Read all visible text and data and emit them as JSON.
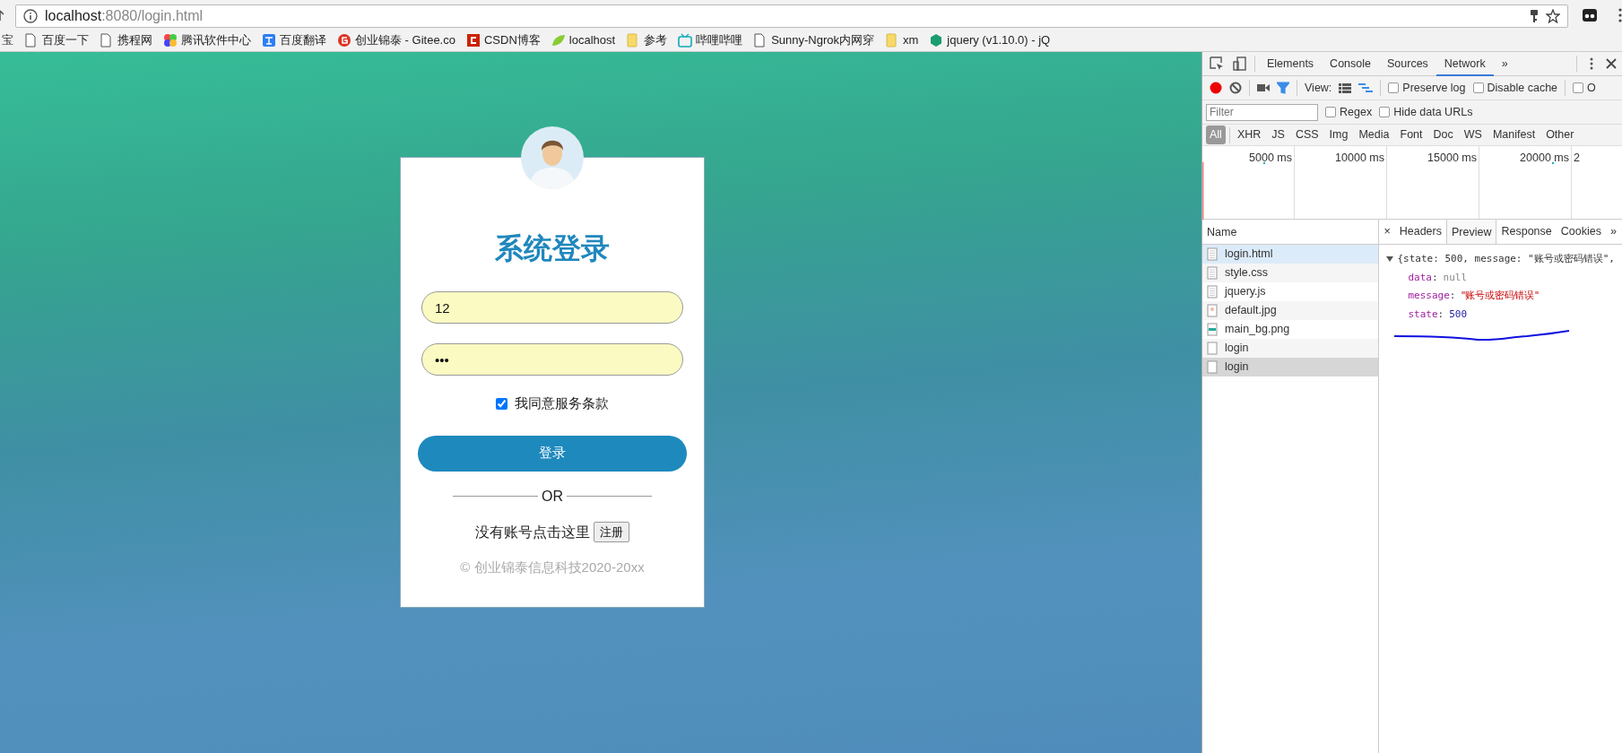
{
  "browser": {
    "url": {
      "host": "localhost",
      "rest": ":8080/login.html"
    },
    "bookmarks": [
      {
        "kind": "none",
        "label": "宝"
      },
      {
        "kind": "page",
        "label": "百度一下"
      },
      {
        "kind": "page",
        "label": "携程网"
      },
      {
        "kind": "pinwheel",
        "label": "腾讯软件中心"
      },
      {
        "kind": "translate",
        "label": "百度翻译"
      },
      {
        "kind": "gitee",
        "label": "创业锦泰 - Gitee.co"
      },
      {
        "kind": "csdn",
        "label": "CSDN博客"
      },
      {
        "kind": "leaf",
        "label": "localhost"
      },
      {
        "kind": "folder",
        "label": "参考"
      },
      {
        "kind": "tv",
        "label": "哔哩哔哩"
      },
      {
        "kind": "page",
        "label": "Sunny-Ngrok内网穿"
      },
      {
        "kind": "folder",
        "label": "xm"
      },
      {
        "kind": "hex",
        "label": "jquery (v1.10.0) - jQ"
      }
    ]
  },
  "login": {
    "title": "系统登录",
    "username": "12",
    "password": "•••",
    "agree": {
      "label": "我同意服务条款",
      "checked": true
    },
    "submit": "登录",
    "divider": "OR",
    "register_prompt": "没有账号点击这里",
    "register_button": "注册",
    "copyright": "© 创业锦泰信息科技2020-20xx"
  },
  "devtools": {
    "tabs": [
      {
        "label": "Elements",
        "selected": false
      },
      {
        "label": "Console",
        "selected": false
      },
      {
        "label": "Sources",
        "selected": false
      },
      {
        "label": "Network",
        "selected": true
      }
    ],
    "tabs_more": "»",
    "toolbar": {
      "recording": true,
      "filter_on": true,
      "view_label": "View:",
      "waterfall_view": true,
      "checkboxes": [
        {
          "label": "Preserve log",
          "checked": false
        },
        {
          "label": "Disable cache",
          "checked": false
        },
        {
          "label": "O",
          "checked": false
        }
      ]
    },
    "filter": {
      "placeholder": "Filter",
      "checkboxes": [
        {
          "label": "Regex",
          "checked": false
        },
        {
          "label": "Hide data URLs",
          "checked": false
        }
      ]
    },
    "types": [
      {
        "label": "All",
        "selected": true
      },
      {
        "label": "XHR",
        "selected": false
      },
      {
        "label": "JS",
        "selected": false
      },
      {
        "label": "CSS",
        "selected": false
      },
      {
        "label": "Img",
        "selected": false
      },
      {
        "label": "Media",
        "selected": false
      },
      {
        "label": "Font",
        "selected": false
      },
      {
        "label": "Doc",
        "selected": false
      },
      {
        "label": "WS",
        "selected": false
      },
      {
        "label": "Manifest",
        "selected": false
      },
      {
        "label": "Other",
        "selected": false
      }
    ],
    "timeline_ticks": [
      "5000 ms",
      "10000 ms",
      "15000 ms",
      "20000 ms",
      "2"
    ],
    "name_header": "Name",
    "requests": [
      {
        "name": "login.html",
        "kind": "document",
        "hovered": true,
        "selected": false
      },
      {
        "name": "style.css",
        "kind": "document",
        "hovered": false,
        "selected": false
      },
      {
        "name": "jquery.js",
        "kind": "document",
        "hovered": false,
        "selected": false
      },
      {
        "name": "default.jpg",
        "kind": "photo",
        "hovered": false,
        "selected": false
      },
      {
        "name": "main_bg.png",
        "kind": "banner",
        "hovered": false,
        "selected": false
      },
      {
        "name": "login",
        "kind": "blank",
        "hovered": false,
        "selected": false
      },
      {
        "name": "login",
        "kind": "blank",
        "hovered": false,
        "selected": true
      }
    ],
    "detail_close": "×",
    "detail_tabs": [
      {
        "label": "Headers",
        "selected": false
      },
      {
        "label": "Preview",
        "selected": true
      },
      {
        "label": "Response",
        "selected": false
      },
      {
        "label": "Cookies",
        "selected": false
      }
    ],
    "detail_more": "»",
    "preview": {
      "expanded": true,
      "summary": "{state: 500, message: \"账号或密码错误\",",
      "properties": [
        {
          "key": "data",
          "colon": ":",
          "value": "null",
          "kind": "null"
        },
        {
          "key": "message",
          "colon": ":",
          "value": "\"账号或密码错误\"",
          "kind": "string"
        },
        {
          "key": "state",
          "colon": ":",
          "value": "500",
          "kind": "number"
        }
      ]
    }
  }
}
